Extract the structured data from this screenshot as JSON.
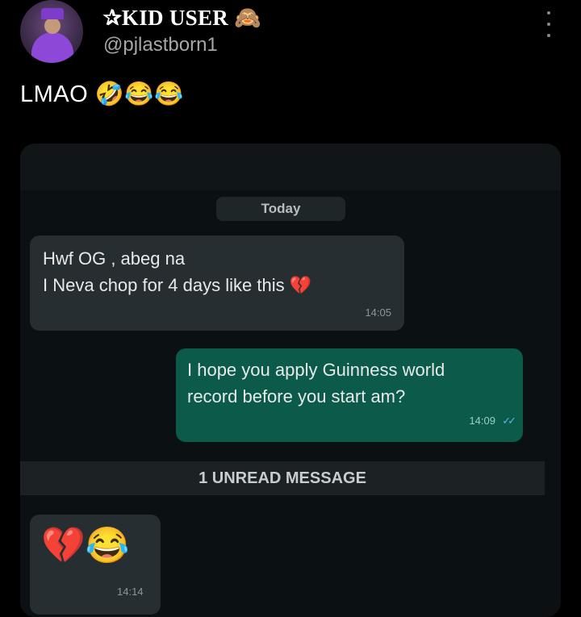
{
  "post": {
    "display_name": "✰KID USER 🙈",
    "username": "@pjlastborn1",
    "caption": "LMAO 🤣😂😂",
    "more_icon": "more-vertical-icon"
  },
  "chat": {
    "date_chip": "Today",
    "messages": [
      {
        "direction": "incoming",
        "line1": "Hwf OG , abeg na",
        "line2": "I Neva chop for 4 days like this 💔",
        "time": "14:05"
      },
      {
        "direction": "outgoing",
        "line1": "I hope you apply Guinness world",
        "line2": "record before you start am?",
        "time": "14:09",
        "status": "read-double-check-icon"
      }
    ],
    "unread_label": "1 UNREAD MESSAGE",
    "emoji_message": {
      "emojis": "💔😂",
      "time": "14:14"
    }
  },
  "colors": {
    "background": "#000000",
    "incoming_bubble": "#272e31",
    "outgoing_bubble": "#0b5a4a",
    "read_ticks": "#5fb4e8"
  }
}
